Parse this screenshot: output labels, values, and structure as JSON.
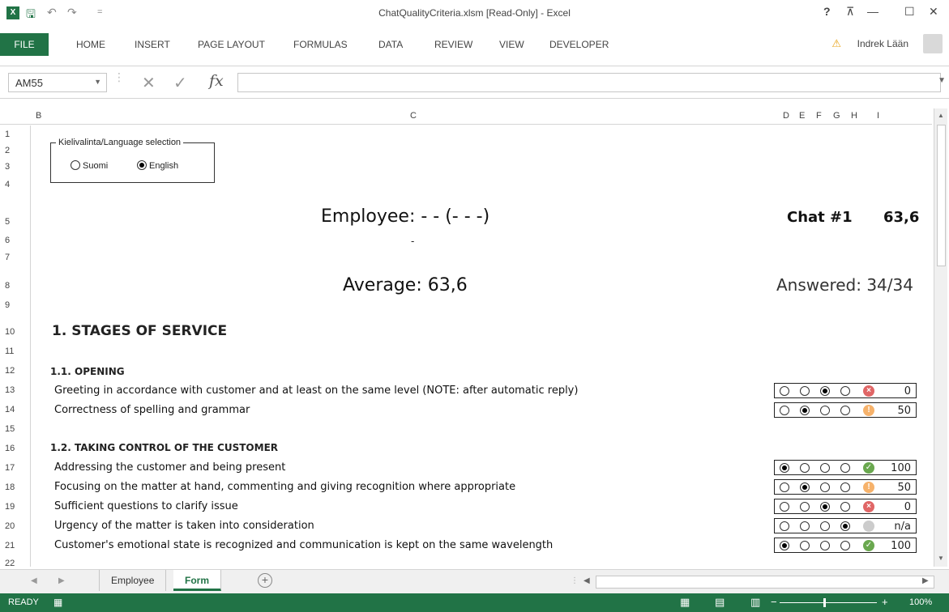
{
  "titlebar": {
    "logo": "X",
    "undo": "↶",
    "redo": "↷",
    "customize": "=",
    "title": "ChatQualityCriteria.xlsm  [Read-Only] - Excel",
    "help": "?",
    "restore_ribbon": "⊼",
    "minimize": "—",
    "maximize": "☐",
    "close": "✕"
  },
  "ribbon": {
    "file": "FILE",
    "tabs": [
      "HOME",
      "INSERT",
      "PAGE LAYOUT",
      "FORMULAS",
      "DATA",
      "REVIEW",
      "VIEW",
      "DEVELOPER"
    ],
    "user": "Indrek Lään"
  },
  "formula_bar": {
    "name_box": "AM55",
    "cancel": "✕",
    "enter": "✓",
    "fx": "fx",
    "formula": ""
  },
  "columns": [
    "B",
    "C",
    "D",
    "E",
    "F",
    "G",
    "H",
    "I"
  ],
  "rows": [
    "1",
    "2",
    "3",
    "4",
    "5",
    "6",
    "7",
    "8",
    "9",
    "10",
    "11",
    "12",
    "13",
    "14",
    "15",
    "16",
    "17",
    "18",
    "19",
    "20",
    "21",
    "22"
  ],
  "language": {
    "legend": "Kielivalinta/Language selection",
    "options": [
      "Suomi",
      "English"
    ],
    "selected": "English"
  },
  "sheet": {
    "employee": "Employee: - - (- - -)",
    "dash": "-",
    "chat_label": "Chat #1",
    "chat_score": "63,6",
    "average": "Average: 63,6",
    "answered": "Answered: 34/34",
    "section": "1. STAGES OF SERVICE",
    "sub1": "1.1. OPENING",
    "sub2": "1.2. TAKING CONTROL OF THE CUSTOMER"
  },
  "criteria": [
    {
      "text": "Greeting in accordance with customer and at least on the same level (NOTE: after automatic reply)",
      "selected": 3,
      "status": "bad",
      "score": "0"
    },
    {
      "text": "Correctness of spelling and grammar",
      "selected": 2,
      "status": "warn",
      "score": "50"
    },
    {
      "text": "Addressing the customer and being present",
      "selected": 1,
      "status": "good",
      "score": "100"
    },
    {
      "text": "Focusing on the matter at hand, commenting and giving recognition where appropriate",
      "selected": 2,
      "status": "warn",
      "score": "50"
    },
    {
      "text": "Sufficient questions to clarify issue",
      "selected": 3,
      "status": "bad",
      "score": "0"
    },
    {
      "text": "Urgency of the matter is taken into consideration",
      "selected": 4,
      "status": "na",
      "score": "n/a"
    },
    {
      "text": "Customer's emotional state is recognized and communication is kept on the same wavelength",
      "selected": 1,
      "status": "good",
      "score": "100"
    }
  ],
  "sheet_tabs": [
    "Employee",
    "Form"
  ],
  "active_tab": "Form",
  "add_sheet": "+",
  "status_bar": {
    "ready": "READY",
    "zoom": "100%",
    "zoom_minus": "−",
    "zoom_plus": "+"
  },
  "colors": {
    "excel_green": "#217346",
    "bad": "#e06666",
    "warn": "#f6b26b",
    "good": "#6aa84f",
    "na": "#cccccc"
  }
}
